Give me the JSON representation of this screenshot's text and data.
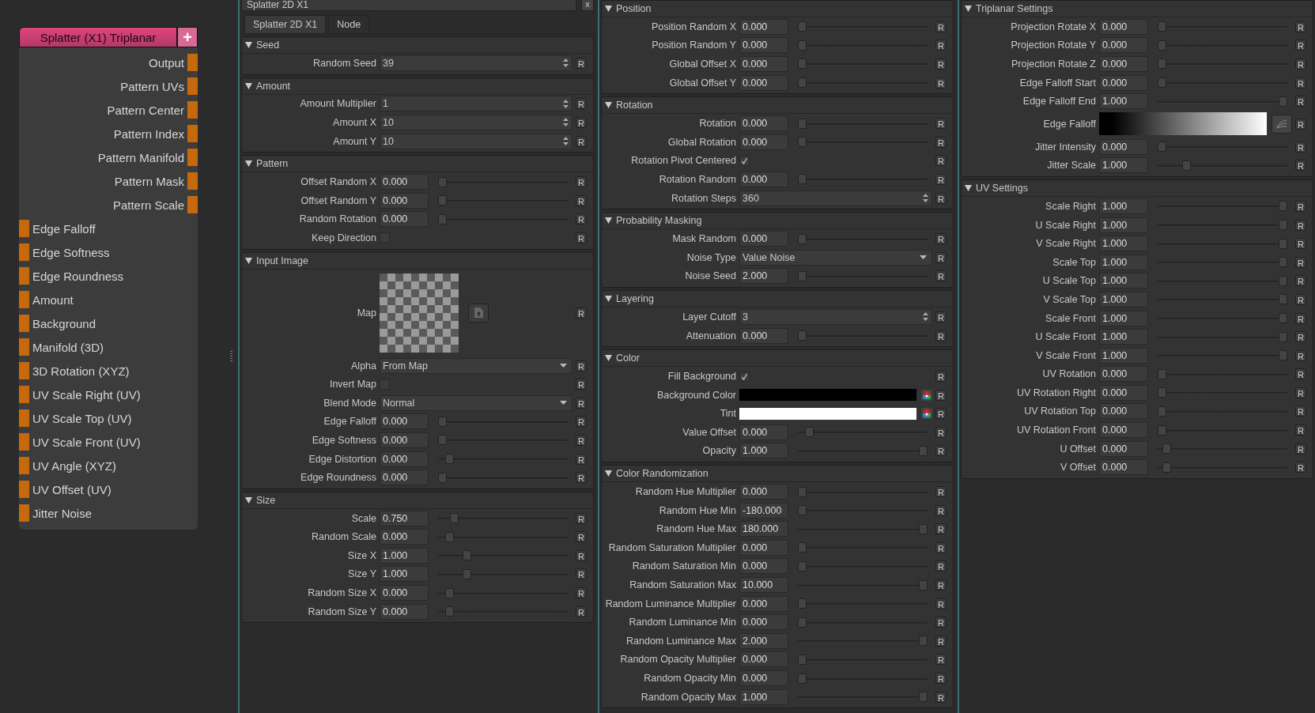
{
  "node": {
    "title": "Splatter (X1) Triplanar",
    "add": "+",
    "ports": [
      {
        "label": "Output",
        "kind": "output"
      },
      {
        "label": "Pattern UVs",
        "kind": "output"
      },
      {
        "label": "Pattern Center",
        "kind": "output"
      },
      {
        "label": "Pattern Index",
        "kind": "output"
      },
      {
        "label": "Pattern Manifold",
        "kind": "output"
      },
      {
        "label": "Pattern Mask",
        "kind": "output"
      },
      {
        "label": "Pattern Scale",
        "kind": "output"
      },
      {
        "label": "Edge Falloff",
        "kind": "input"
      },
      {
        "label": "Edge Softness",
        "kind": "input"
      },
      {
        "label": "Edge Roundness",
        "kind": "input"
      },
      {
        "label": "Amount",
        "kind": "input"
      },
      {
        "label": "Background",
        "kind": "input"
      },
      {
        "label": "Manifold (3D)",
        "kind": "input"
      },
      {
        "label": "3D Rotation (XYZ)",
        "kind": "input"
      },
      {
        "label": "UV Scale Right (UV)",
        "kind": "input"
      },
      {
        "label": "UV Scale Top (UV)",
        "kind": "input"
      },
      {
        "label": "UV Scale Front (UV)",
        "kind": "input"
      },
      {
        "label": "UV Angle (XYZ)",
        "kind": "input"
      },
      {
        "label": "UV Offset (UV)",
        "kind": "input"
      },
      {
        "label": "Jitter Noise",
        "kind": "input"
      }
    ]
  },
  "panel_title": "Splatter 2D X1",
  "close": "x",
  "tabs": [
    {
      "label": "Splatter 2D X1",
      "selected": true
    },
    {
      "label": "Node",
      "selected": false
    }
  ],
  "columns": [
    {
      "sections": [
        {
          "title": "Seed",
          "expanded": true,
          "rows": [
            {
              "kind": "spin",
              "label": "Random Seed",
              "value": "39",
              "reset": "R"
            }
          ]
        },
        {
          "title": "Amount",
          "expanded": true,
          "rows": [
            {
              "kind": "spin",
              "label": "Amount Multiplier",
              "value": "1",
              "reset": "R"
            },
            {
              "kind": "spin",
              "label": "Amount X",
              "value": "10",
              "reset": "R"
            },
            {
              "kind": "spin",
              "label": "Amount Y",
              "value": "10",
              "reset": "R"
            }
          ]
        },
        {
          "title": "Pattern",
          "expanded": true,
          "rows": [
            {
              "kind": "slider",
              "label": "Offset Random X",
              "value": "0.000",
              "level": 0,
              "reset": "R"
            },
            {
              "kind": "slider",
              "label": "Offset Random Y",
              "value": "0.000",
              "level": 0,
              "reset": "R"
            },
            {
              "kind": "slider",
              "label": "Random Rotation",
              "value": "0.000",
              "level": 0,
              "reset": "R"
            },
            {
              "kind": "check",
              "label": "Keep Direction",
              "checked": false,
              "reset": "R"
            }
          ]
        },
        {
          "title": "Input Image",
          "expanded": true,
          "rows": [
            {
              "kind": "image",
              "label": "Map",
              "reset": "R"
            },
            {
              "kind": "dropdown",
              "label": "Alpha",
              "value": "From Map",
              "reset": "R"
            },
            {
              "kind": "check",
              "label": "Invert Map",
              "checked": false,
              "reset": "R"
            },
            {
              "kind": "dropdown",
              "label": "Blend Mode",
              "value": "Normal",
              "reset": "R"
            },
            {
              "kind": "slider",
              "label": "Edge Falloff",
              "value": "0.000",
              "level": 0,
              "reset": "R"
            },
            {
              "kind": "slider",
              "label": "Edge Softness",
              "value": "0.000",
              "level": 0,
              "reset": "R"
            },
            {
              "kind": "slider",
              "label": "Edge Distortion",
              "value": "0.000",
              "level": 0.06,
              "reset": "R"
            },
            {
              "kind": "slider",
              "label": "Edge Roundness",
              "value": "0.000",
              "level": 0,
              "reset": "R"
            }
          ]
        },
        {
          "title": "Size",
          "expanded": true,
          "rows": [
            {
              "kind": "slider",
              "label": "Scale",
              "value": "0.750",
              "level": 0.1,
              "reset": "R"
            },
            {
              "kind": "slider",
              "label": "Random Scale",
              "value": "0.000",
              "level": 0.06,
              "reset": "R"
            },
            {
              "kind": "slider",
              "label": "Size X",
              "value": "1.000",
              "level": 0.2,
              "reset": "R"
            },
            {
              "kind": "slider",
              "label": "Size Y",
              "value": "1.000",
              "level": 0.2,
              "reset": "R"
            },
            {
              "kind": "slider",
              "label": "Random Size X",
              "value": "0.000",
              "level": 0.06,
              "reset": "R"
            },
            {
              "kind": "slider",
              "label": "Random Size Y",
              "value": "0.000",
              "level": 0.06,
              "reset": "R"
            }
          ]
        }
      ]
    },
    {
      "sections": [
        {
          "title": "Position",
          "expanded": true,
          "rows": [
            {
              "kind": "slider",
              "label": "Position Random X",
              "value": "0.000",
              "level": 0,
              "reset": "R"
            },
            {
              "kind": "slider",
              "label": "Position Random Y",
              "value": "0.000",
              "level": 0,
              "reset": "R"
            },
            {
              "kind": "slider",
              "label": "Global Offset X",
              "value": "0.000",
              "level": 0,
              "reset": "R"
            },
            {
              "kind": "slider",
              "label": "Global Offset Y",
              "value": "0.000",
              "level": 0,
              "reset": "R"
            }
          ]
        },
        {
          "title": "Rotation",
          "expanded": true,
          "rows": [
            {
              "kind": "slider",
              "label": "Rotation",
              "value": "0.000",
              "level": 0,
              "reset": "R"
            },
            {
              "kind": "slider",
              "label": "Global Rotation",
              "value": "0.000",
              "level": 0,
              "reset": "R"
            },
            {
              "kind": "check",
              "label": "Rotation Pivot Centered",
              "checked": true,
              "reset": "R"
            },
            {
              "kind": "slider",
              "label": "Rotation Random",
              "value": "0.000",
              "level": 0,
              "reset": "R"
            },
            {
              "kind": "spin",
              "label": "Rotation Steps",
              "value": "360",
              "reset": "R"
            }
          ]
        },
        {
          "title": "Probability Masking",
          "expanded": true,
          "rows": [
            {
              "kind": "slider",
              "label": "Mask Random",
              "value": "0.000",
              "level": 0,
              "reset": "R"
            },
            {
              "kind": "dropdown",
              "label": "Noise Type",
              "value": "Value Noise",
              "reset": "R"
            },
            {
              "kind": "slider",
              "label": "Noise Seed",
              "value": "2.000",
              "level": 0,
              "reset": "R"
            }
          ]
        },
        {
          "title": "Layering",
          "expanded": true,
          "rows": [
            {
              "kind": "spin",
              "label": "Layer Cutoff",
              "value": "3",
              "reset": "R"
            },
            {
              "kind": "slider",
              "label": "Attenuation",
              "value": "0.000",
              "level": 0,
              "reset": "R"
            }
          ]
        },
        {
          "title": "Color",
          "expanded": true,
          "rows": [
            {
              "kind": "check",
              "label": "Fill Background",
              "checked": true,
              "reset": "R"
            },
            {
              "kind": "color",
              "label": "Background Color",
              "color": "#000000",
              "reset": "R"
            },
            {
              "kind": "color",
              "label": "Tint",
              "color": "#ffffff",
              "reset": "R"
            },
            {
              "kind": "slider",
              "label": "Value Offset",
              "value": "0.000",
              "level": 0.06,
              "reset": "R"
            },
            {
              "kind": "slider",
              "label": "Opacity",
              "value": "1.000",
              "level": 1,
              "reset": "R"
            }
          ]
        },
        {
          "title": "Color Randomization",
          "expanded": true,
          "rows": [
            {
              "kind": "slider",
              "label": "Random Hue Multiplier",
              "value": "0.000",
              "level": 0,
              "reset": "R"
            },
            {
              "kind": "slider",
              "label": "Random Hue Min",
              "value": "-180.000",
              "level": 0,
              "reset": "R"
            },
            {
              "kind": "slider",
              "label": "Random Hue Max",
              "value": "180.000",
              "level": 1,
              "reset": "R"
            },
            {
              "kind": "slider",
              "label": "Random Saturation Multiplier",
              "value": "0.000",
              "level": 0,
              "reset": "R"
            },
            {
              "kind": "slider",
              "label": "Random Saturation Min",
              "value": "0.000",
              "level": 0,
              "reset": "R"
            },
            {
              "kind": "slider",
              "label": "Random Saturation Max",
              "value": "10.000",
              "level": 1,
              "reset": "R"
            },
            {
              "kind": "slider",
              "label": "Random Luminance Multiplier",
              "value": "0.000",
              "level": 0,
              "reset": "R"
            },
            {
              "kind": "slider",
              "label": "Random Luminance Min",
              "value": "0.000",
              "level": 0,
              "reset": "R"
            },
            {
              "kind": "slider",
              "label": "Random Luminance Max",
              "value": "2.000",
              "level": 1,
              "reset": "R"
            },
            {
              "kind": "slider",
              "label": "Random Opacity Multiplier",
              "value": "0.000",
              "level": 0,
              "reset": "R"
            },
            {
              "kind": "slider",
              "label": "Random Opacity Min",
              "value": "0.000",
              "level": 0,
              "reset": "R"
            },
            {
              "kind": "slider",
              "label": "Random Opacity Max",
              "value": "1.000",
              "level": 1,
              "reset": "R"
            }
          ]
        }
      ]
    },
    {
      "sections": [
        {
          "title": "Triplanar Settings",
          "expanded": true,
          "rows": [
            {
              "kind": "slider",
              "label": "Projection Rotate X",
              "value": "0.000",
              "level": 0,
              "reset": "R"
            },
            {
              "kind": "slider",
              "label": "Projection Rotate Y",
              "value": "0.000",
              "level": 0,
              "reset": "R"
            },
            {
              "kind": "slider",
              "label": "Projection Rotate Z",
              "value": "0.000",
              "level": 0,
              "reset": "R"
            },
            {
              "kind": "slider",
              "label": "Edge Falloff Start",
              "value": "0.000",
              "level": 0,
              "reset": "R"
            },
            {
              "kind": "slider",
              "label": "Edge Falloff End",
              "value": "1.000",
              "level": 1,
              "reset": "R"
            },
            {
              "kind": "gradient",
              "label": "Edge Falloff",
              "reset": "R"
            },
            {
              "kind": "slider",
              "label": "Jitter Intensity",
              "value": "0.000",
              "level": 0,
              "reset": "R"
            },
            {
              "kind": "slider",
              "label": "Jitter Scale",
              "value": "1.000",
              "level": 0.2,
              "reset": "R"
            }
          ]
        },
        {
          "title": "UV Settings",
          "expanded": true,
          "rows": [
            {
              "kind": "slider",
              "label": "Scale Right",
              "value": "1.000",
              "level": 1,
              "reset": "R"
            },
            {
              "kind": "slider",
              "label": "U Scale Right",
              "value": "1.000",
              "level": 1,
              "reset": "R"
            },
            {
              "kind": "slider",
              "label": "V Scale Right",
              "value": "1.000",
              "level": 1,
              "reset": "R"
            },
            {
              "kind": "slider",
              "label": "Scale Top",
              "value": "1.000",
              "level": 1,
              "reset": "R"
            },
            {
              "kind": "slider",
              "label": "U Scale Top",
              "value": "1.000",
              "level": 1,
              "reset": "R"
            },
            {
              "kind": "slider",
              "label": "V Scale Top",
              "value": "1.000",
              "level": 1,
              "reset": "R"
            },
            {
              "kind": "slider",
              "label": "Scale Front",
              "value": "1.000",
              "level": 1,
              "reset": "R"
            },
            {
              "kind": "slider",
              "label": "U Scale Front",
              "value": "1.000",
              "level": 1,
              "reset": "R"
            },
            {
              "kind": "slider",
              "label": "V Scale Front",
              "value": "1.000",
              "level": 1,
              "reset": "R"
            },
            {
              "kind": "slider",
              "label": "UV Rotation",
              "value": "0.000",
              "level": 0,
              "reset": "R"
            },
            {
              "kind": "slider",
              "label": "UV Rotation Right",
              "value": "0.000",
              "level": 0,
              "reset": "R"
            },
            {
              "kind": "slider",
              "label": "UV Rotation Top",
              "value": "0.000",
              "level": 0,
              "reset": "R"
            },
            {
              "kind": "slider",
              "label": "UV Rotation Front",
              "value": "0.000",
              "level": 0,
              "reset": "R"
            },
            {
              "kind": "slider",
              "label": "U Offset",
              "value": "0.000",
              "level": 0.04,
              "reset": "R"
            },
            {
              "kind": "slider",
              "label": "V Offset",
              "value": "0.000",
              "level": 0.04,
              "reset": "R"
            }
          ]
        }
      ]
    }
  ]
}
